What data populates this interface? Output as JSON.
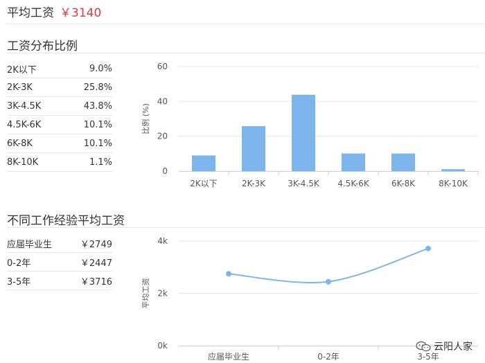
{
  "avg_salary": {
    "label": "平均工资",
    "value": "￥3140"
  },
  "distribution": {
    "title": "工资分布比例",
    "items": [
      {
        "label": "2K以下",
        "value": "9.0%"
      },
      {
        "label": "2K-3K",
        "value": "25.8%"
      },
      {
        "label": "3K-4.5K",
        "value": "43.8%"
      },
      {
        "label": "4.5K-6K",
        "value": "10.1%"
      },
      {
        "label": "6K-8K",
        "value": "10.1%"
      },
      {
        "label": "8K-10K",
        "value": "1.1%"
      }
    ]
  },
  "experience": {
    "title": "不同工作经验平均工资",
    "items": [
      {
        "label": "应届毕业生",
        "value": "￥2749"
      },
      {
        "label": "0-2年",
        "value": "￥2447"
      },
      {
        "label": "3-5年",
        "value": "￥3716"
      }
    ]
  },
  "watermark": {
    "text": "云阳人家",
    "icon": "wechat-icon"
  },
  "colors": {
    "bar": "#7cb5ec",
    "line": "#7cb5ec",
    "price": "#e4393c"
  },
  "chart_data": [
    {
      "type": "bar",
      "categories": [
        "2K以下",
        "2K-3K",
        "3K-4.5K",
        "4.5K-6K",
        "6K-8K",
        "8K-10K"
      ],
      "values": [
        9.0,
        25.8,
        43.8,
        10.1,
        10.1,
        1.1
      ],
      "ylabel": "比例 (%)",
      "ylim": [
        0,
        60
      ],
      "yticks": [
        0,
        20,
        40,
        60
      ],
      "grid": true
    },
    {
      "type": "line",
      "categories": [
        "应届毕业生",
        "0-2年",
        "3-5年"
      ],
      "values": [
        2749,
        2447,
        3716
      ],
      "ylabel": "平均工资",
      "ylim": [
        0,
        4000
      ],
      "yticks": [
        0,
        2000,
        4000
      ],
      "ytick_labels": [
        "0k",
        "2k",
        "4k"
      ],
      "grid": true
    }
  ]
}
